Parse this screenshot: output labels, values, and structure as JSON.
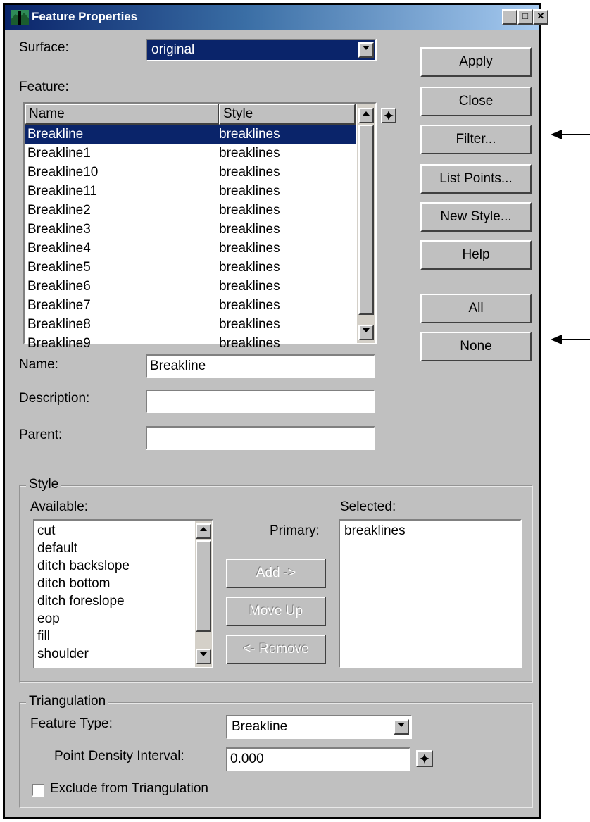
{
  "window": {
    "title": "Feature Properties"
  },
  "surface": {
    "label": "Surface:",
    "value": "original"
  },
  "feature": {
    "label": "Feature:",
    "columns": {
      "name": "Name",
      "style": "Style"
    },
    "rows": [
      {
        "name": "Breakline",
        "style": "breaklines"
      },
      {
        "name": "Breakline1",
        "style": "breaklines"
      },
      {
        "name": "Breakline10",
        "style": "breaklines"
      },
      {
        "name": "Breakline11",
        "style": "breaklines"
      },
      {
        "name": "Breakline2",
        "style": "breaklines"
      },
      {
        "name": "Breakline3",
        "style": "breaklines"
      },
      {
        "name": "Breakline4",
        "style": "breaklines"
      },
      {
        "name": "Breakline5",
        "style": "breaklines"
      },
      {
        "name": "Breakline6",
        "style": "breaklines"
      },
      {
        "name": "Breakline7",
        "style": "breaklines"
      },
      {
        "name": "Breakline8",
        "style": "breaklines"
      },
      {
        "name": "Breakline9",
        "style": "breaklines"
      }
    ]
  },
  "buttons": {
    "apply": "Apply",
    "close": "Close",
    "filter": "Filter...",
    "list_points": "List Points...",
    "new_style": "New Style...",
    "help": "Help",
    "all": "All",
    "none": "None"
  },
  "fields": {
    "name_label": "Name:",
    "name_value": "Breakline",
    "description_label": "Description:",
    "description_value": "",
    "parent_label": "Parent:",
    "parent_value": ""
  },
  "style": {
    "group_label": "Style",
    "available_label": "Available:",
    "selected_label": "Selected:",
    "primary_label": "Primary:",
    "available_items": [
      "cut",
      "default",
      "ditch backslope",
      "ditch bottom",
      "ditch foreslope",
      "eop",
      "fill",
      "shoulder"
    ],
    "selected_items": [
      "breaklines"
    ],
    "add_button": "Add ->",
    "move_up_button": "Move Up",
    "remove_button": "<- Remove"
  },
  "triangulation": {
    "group_label": "Triangulation",
    "feature_type_label": "Feature Type:",
    "feature_type_value": "Breakline",
    "point_density_label": "Point Density Interval:",
    "point_density_value": "0.000",
    "exclude_label": "Exclude from Triangulation",
    "exclude_checked": false
  },
  "colors": {
    "title_bar": "#0a246a",
    "selection": "#0a246a",
    "face": "#c0c0c0"
  }
}
